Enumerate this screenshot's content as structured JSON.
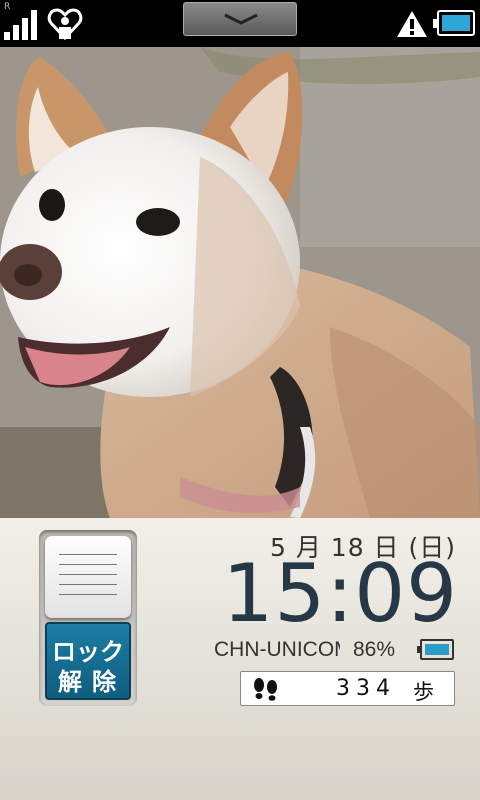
{
  "status_bar": {
    "roaming_indicator": "R",
    "signal_level": "4/4",
    "icons": [
      "signal-icon",
      "heart-icon",
      "pulldown-handle",
      "warning-icon",
      "battery-icon"
    ],
    "battery_color": "#2fa6d8"
  },
  "wallpaper": {
    "description_icon": "dog-photo"
  },
  "lock_panel": {
    "date": "5 月 18 日 (日)",
    "time": "15:09",
    "carrier": "CHN-UNICOM",
    "battery_percent": "86%",
    "unlock_line1": "ロック",
    "unlock_line2": "解除",
    "steps_value": "334",
    "steps_unit": "歩",
    "accent_color": "#1d7ea5"
  }
}
